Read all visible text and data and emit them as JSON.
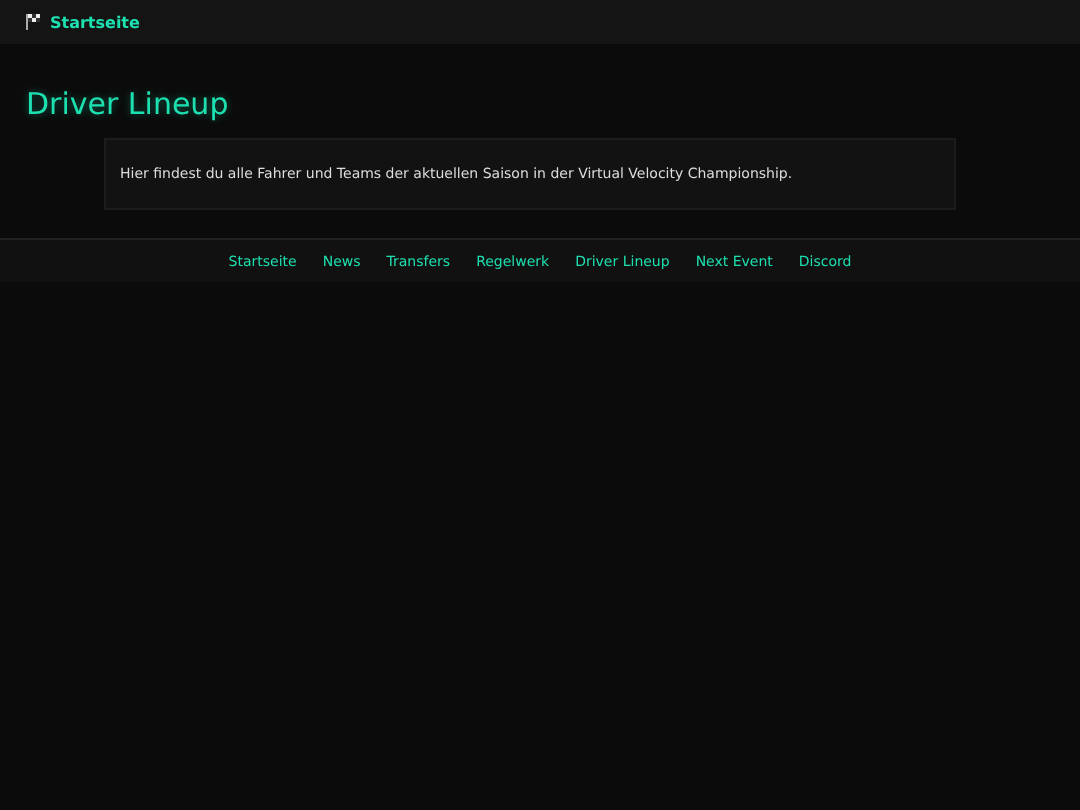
{
  "header": {
    "home_link": "Startseite"
  },
  "page": {
    "title": "Driver Lineup",
    "intro": "Hier findest du alle Fahrer und Teams der aktuellen Saison in der Virtual Velocity Championship."
  },
  "footer_nav": [
    "Startseite",
    "News",
    "Transfers",
    "Regelwerk",
    "Driver Lineup",
    "Next Event",
    "Discord"
  ]
}
